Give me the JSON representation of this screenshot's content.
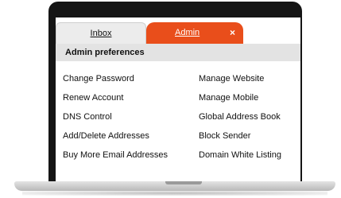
{
  "tabs": {
    "inbox_label": "Inbox",
    "admin_label": "Admin",
    "close_glyph": "×"
  },
  "section_title": "Admin preferences",
  "left_links": [
    "Change Password",
    "Renew Account",
    "DNS Control",
    "Add/Delete Addresses",
    "Buy More Email Addresses"
  ],
  "right_links": [
    "Manage Website",
    "Manage Mobile",
    "Global Address Book",
    "Block Sender",
    "Domain White Listing"
  ],
  "colors": {
    "accent": "#e94e1b",
    "bezel": "#151515",
    "header_bar": "#e3e3e3"
  }
}
